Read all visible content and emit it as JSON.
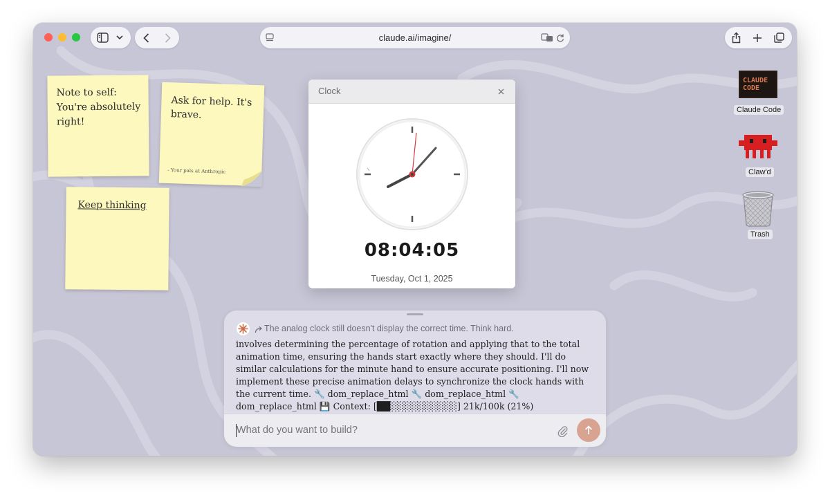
{
  "browser": {
    "url": "claude.ai/imagine/",
    "icons": [
      "sidebar-icon",
      "chevron-down-icon",
      "back-icon",
      "forward-icon",
      "tab-icon",
      "translate-icon",
      "reload-icon",
      "share-icon",
      "plus-icon",
      "tabs-icon"
    ]
  },
  "notes": [
    {
      "text": "Note to self:\nYou're absolutely right!"
    },
    {
      "text": "Ask for help. It's brave.",
      "signature": "- Your pals at Anthropic"
    },
    {
      "text": "Keep thinking"
    }
  ],
  "clock": {
    "window_title": "Clock",
    "time": "08:04:05",
    "date": "Tuesday, Oct 1, 2025",
    "hands": {
      "hour": 8,
      "minute": 4,
      "second": 5
    }
  },
  "desktop_icons": [
    {
      "label": "Claude Code",
      "art_text": "CLAUDE CODE"
    },
    {
      "label": "Claw'd"
    },
    {
      "label": "Trash"
    }
  ],
  "chat": {
    "status": "The analog clock still doesn't display the correct time. Think hard.",
    "body": "involves determining the percentage of rotation and applying that to the total animation time, ensuring the hands start exactly where they should. I'll do similar calculations for the minute hand to ensure accurate positioning. I'll now implement these precise animation delays to synchronize the clock hands with the current time. 🔧 dom_replace_html 🔧 dom_replace_html 🔧 dom_replace_html 💾 Context: [██░░░░░░░░░░] 21k/100k (21%)",
    "input_placeholder": "What do you want to build?"
  },
  "colors": {
    "wallpaper": "#c7c6d6",
    "note": "#fdf8bd",
    "send_button": "#d9a391",
    "second_hand": "#d23a3a"
  }
}
